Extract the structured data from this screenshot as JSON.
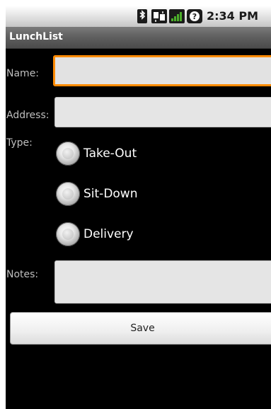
{
  "status_bar": {
    "time": "2:34 PM",
    "icons": [
      "bluetooth-icon",
      "data-transfer-icon",
      "signal-icon",
      "help-icon"
    ]
  },
  "app": {
    "title": "LunchList"
  },
  "form": {
    "name_label": "Name:",
    "name_value": "",
    "address_label": "Address:",
    "address_value": "",
    "type_label": "Type:",
    "type_options": [
      "Take-Out",
      "Sit-Down",
      "Delivery"
    ],
    "notes_label": "Notes:",
    "notes_value": "",
    "save_label": "Save"
  },
  "colors": {
    "focus": "#ff8a00",
    "background": "#000000",
    "title_bar": "#5e5e5e"
  }
}
